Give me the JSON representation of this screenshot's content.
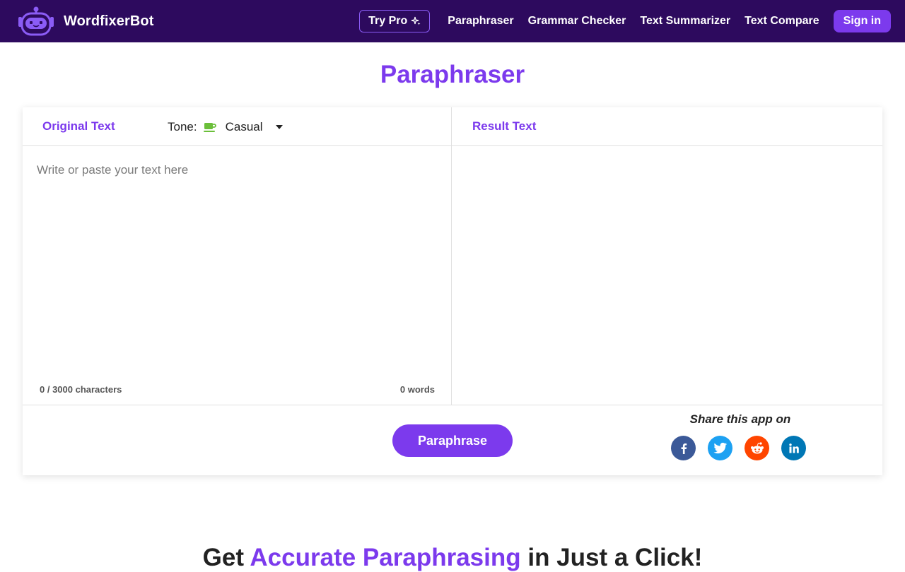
{
  "header": {
    "brand_name": "WordfixerBot",
    "try_pro_label": "Try Pro",
    "nav": [
      {
        "label": "Paraphraser"
      },
      {
        "label": "Grammar Checker"
      },
      {
        "label": "Text Summarizer"
      },
      {
        "label": "Text Compare"
      }
    ],
    "signin_label": "Sign in"
  },
  "page": {
    "title": "Paraphraser"
  },
  "editor": {
    "original_label": "Original Text",
    "tone_label": "Tone:",
    "tone_value": "Casual",
    "placeholder": "Write or paste your text here",
    "char_count": "0 / 3000 characters",
    "word_count": "0 words",
    "result_label": "Result Text",
    "paraphrase_label": "Paraphrase"
  },
  "share": {
    "label": "Share this app on",
    "icons": [
      "facebook-icon",
      "twitter-icon",
      "reddit-icon",
      "linkedin-icon"
    ]
  },
  "promo": {
    "part1": "Get ",
    "accent": "Accurate Paraphrasing",
    "part2": " in Just a Click!"
  },
  "colors": {
    "nav_bg": "#2d0a5e",
    "accent": "#7c3aed",
    "facebook": "#3b5998",
    "twitter": "#1da1f2",
    "reddit": "#ff4500",
    "linkedin": "#0077b5"
  }
}
